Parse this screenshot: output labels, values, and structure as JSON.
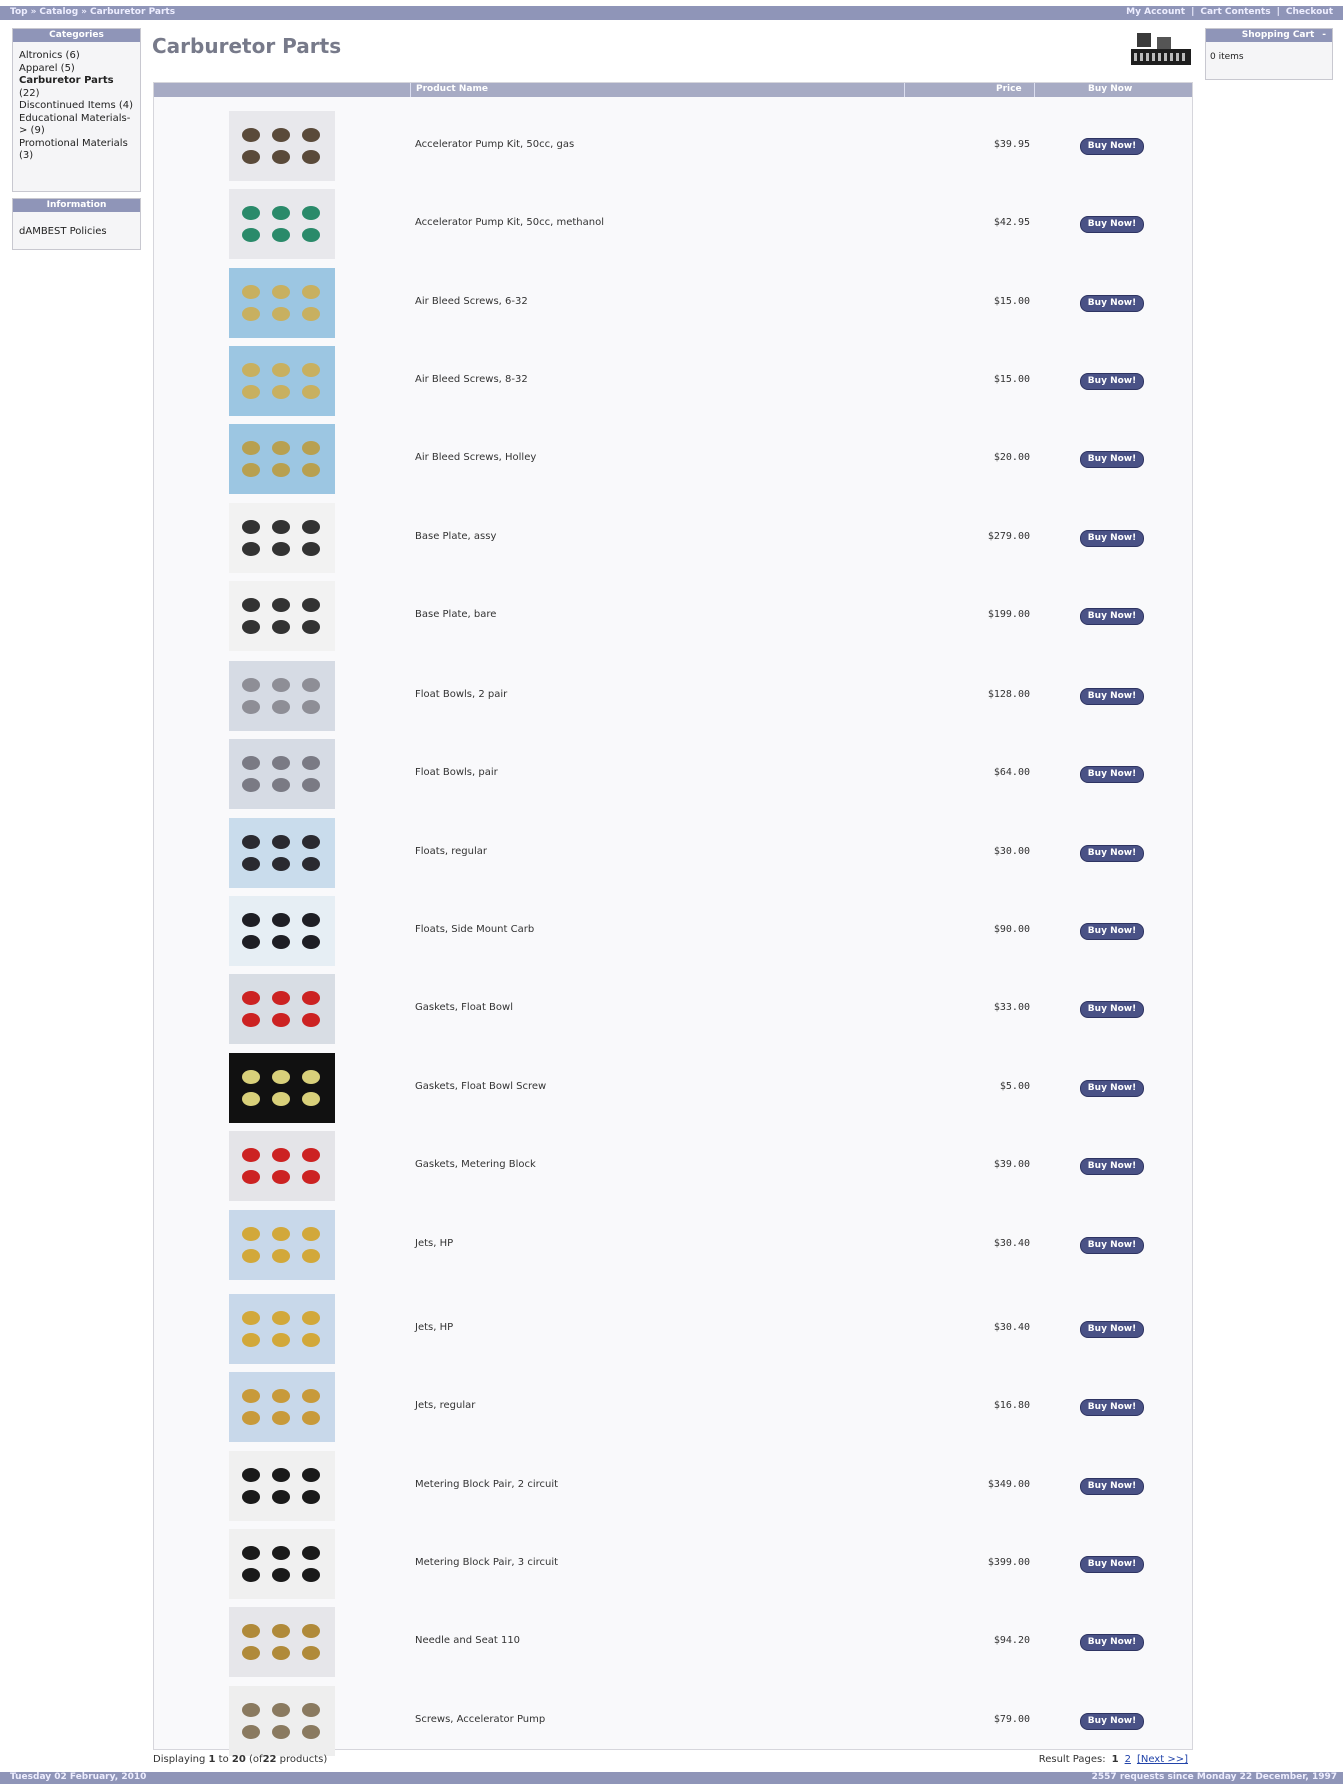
{
  "breadcrumb": [
    "Top",
    "Catalog",
    "Carburetor Parts"
  ],
  "header_links": [
    "My Account",
    "Cart Contents",
    "Checkout"
  ],
  "categories_box": {
    "title": "Categories",
    "items": [
      {
        "label": "Altronics (6)",
        "current": false
      },
      {
        "label": "Apparel (5)",
        "current": false
      },
      {
        "label": "Carburetor Parts",
        "count": "(22)",
        "current": true
      },
      {
        "label": "Discontinued Items (4)",
        "current": false
      },
      {
        "label": "Educational Materials-> (9)",
        "current": false
      },
      {
        "label": "Promotional Materials (3)",
        "current": false
      }
    ]
  },
  "information_box": {
    "title": "Information",
    "items": [
      "dAMBEST Policies"
    ]
  },
  "cart_box": {
    "title": "Shopping Cart",
    "toggle": "-",
    "content": "0 items"
  },
  "page_title": "Carburetor Parts",
  "table_headers": {
    "name": "Product Name",
    "price": "Price",
    "buy": "Buy Now"
  },
  "buy_label": "Buy Now!",
  "products": [
    {
      "name": "Accelerator Pump Kit, 50cc, gas",
      "price": "$39.95"
    },
    {
      "name": "Accelerator Pump Kit, 50cc, methanol",
      "price": "$42.95"
    },
    {
      "name": "Air Bleed Screws, 6-32",
      "price": "$15.00"
    },
    {
      "name": "Air Bleed Screws, 8-32",
      "price": "$15.00"
    },
    {
      "name": "Air Bleed Screws, Holley",
      "price": "$20.00"
    },
    {
      "name": "Base Plate, assy",
      "price": "$279.00"
    },
    {
      "name": "Base Plate, bare",
      "price": "$199.00"
    },
    {
      "name": "Float Bowls, 2 pair",
      "price": "$128.00"
    },
    {
      "name": "Float Bowls, pair",
      "price": "$64.00"
    },
    {
      "name": "Floats, regular",
      "price": "$30.00"
    },
    {
      "name": "Floats, Side Mount Carb",
      "price": "$90.00"
    },
    {
      "name": "Gaskets, Float Bowl",
      "price": "$33.00"
    },
    {
      "name": "Gaskets, Float Bowl Screw",
      "price": "$5.00"
    },
    {
      "name": "Gaskets, Metering Block",
      "price": "$39.00"
    },
    {
      "name": "Jets, HP",
      "price": "$30.40"
    },
    {
      "name": "Jets, HP",
      "price": "$30.40"
    },
    {
      "name": "Jets, regular",
      "price": "$16.80"
    },
    {
      "name": "Metering Block Pair, 2 circuit",
      "price": "$349.00"
    },
    {
      "name": "Metering Block Pair, 3 circuit",
      "price": "$399.00"
    },
    {
      "name": "Needle and Seat 110",
      "price": "$94.20"
    },
    {
      "name": "Screws, Accelerator Pump",
      "price": "$79.00"
    }
  ],
  "listing_footer": {
    "prefix": "Displaying",
    "from": "1",
    "to_word": "to",
    "to": "20",
    "suffix_open": "(of",
    "total": "22",
    "suffix_close": "products)",
    "pages_label": "Result Pages:",
    "current_page": "1",
    "other_page": "2",
    "next": "[Next >>]"
  },
  "bottom_bar": {
    "date": "Tuesday 02 February, 2010",
    "requests": "2557 requests since Monday 22 December, 1997"
  },
  "colors": {
    "bar": "#8f95b8",
    "table_header": "#a7abc4",
    "buy_button": "#4a5286"
  }
}
